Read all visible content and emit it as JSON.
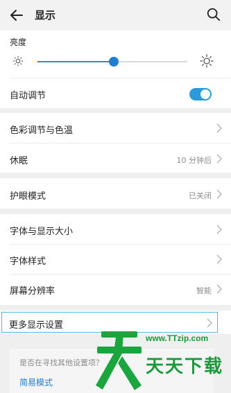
{
  "header": {
    "title": "显示",
    "back_icon": "arrow-left-icon",
    "search_icon": "search-icon"
  },
  "brightness": {
    "label": "亮度",
    "level": 0.51,
    "low_icon": "sun-small-icon",
    "high_icon": "sun-large-icon",
    "accent": "#1e7fd2"
  },
  "auto_adjust": {
    "label": "自动调节",
    "enabled": true,
    "color": "#2a9bd8"
  },
  "items": {
    "color_temp": {
      "label": "色彩调节与色温"
    },
    "sleep": {
      "label": "休眠",
      "value": "10 分钟后"
    },
    "eye_care": {
      "label": "护眼模式",
      "value": "已关闭"
    },
    "font_size": {
      "label": "字体与显示大小"
    },
    "font_style": {
      "label": "字体样式"
    },
    "resolution": {
      "label": "屏幕分辨率",
      "value": "智能"
    },
    "more": {
      "label": "更多显示设置"
    }
  },
  "suggest": {
    "question": "是否在寻找其他设置项？",
    "link": "简易模式"
  },
  "watermark": {
    "url": "www.TTzip.com",
    "text": "天天下载",
    "color": "#1a9a3a"
  }
}
